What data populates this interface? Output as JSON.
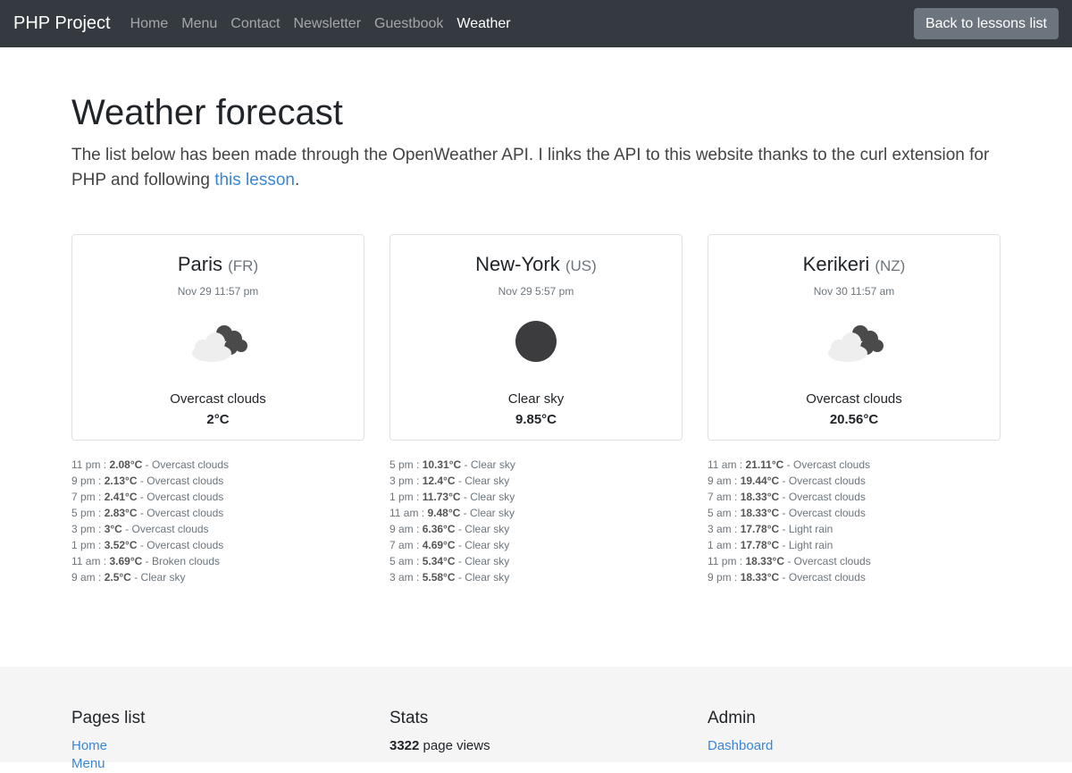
{
  "nav": {
    "brand": "PHP Project",
    "items": [
      "Home",
      "Menu",
      "Contact",
      "Newsletter",
      "Guestbook",
      "Weather"
    ],
    "active": "Weather",
    "back_label": "Back to lessons list"
  },
  "main": {
    "title": "Weather forecast",
    "lead_text": "The list below has been made through the OpenWeather API. I links the API to this website thanks to the curl extension for PHP and following ",
    "lead_link": "this lesson",
    "lead_end": "."
  },
  "cities": [
    {
      "name": "Paris",
      "country": "(FR)",
      "date": "Nov 29 11:57 pm",
      "icon": "overcast-clouds-icon",
      "description": "Overcast clouds",
      "temp": "2°C",
      "forecast": [
        {
          "time": "11 pm",
          "temp": "2.08°C",
          "desc": "Overcast clouds"
        },
        {
          "time": "9 pm",
          "temp": "2.13°C",
          "desc": "Overcast clouds"
        },
        {
          "time": "7 pm",
          "temp": "2.41°C",
          "desc": "Overcast clouds"
        },
        {
          "time": "5 pm",
          "temp": "2.83°C",
          "desc": "Overcast clouds"
        },
        {
          "time": "3 pm",
          "temp": "3°C",
          "desc": "Overcast clouds"
        },
        {
          "time": "1 pm",
          "temp": "3.52°C",
          "desc": "Overcast clouds"
        },
        {
          "time": "11 am",
          "temp": "3.69°C",
          "desc": "Broken clouds"
        },
        {
          "time": "9 am",
          "temp": "2.5°C",
          "desc": "Clear sky"
        }
      ]
    },
    {
      "name": "New-York",
      "country": "(US)",
      "date": "Nov 29 5:57 pm",
      "icon": "clear-night-moon-icon",
      "description": "Clear sky",
      "temp": "9.85°C",
      "forecast": [
        {
          "time": "5 pm",
          "temp": "10.31°C",
          "desc": "Clear sky"
        },
        {
          "time": "3 pm",
          "temp": "12.4°C",
          "desc": "Clear sky"
        },
        {
          "time": "1 pm",
          "temp": "11.73°C",
          "desc": "Clear sky"
        },
        {
          "time": "11 am",
          "temp": "9.48°C",
          "desc": "Clear sky"
        },
        {
          "time": "9 am",
          "temp": "6.36°C",
          "desc": "Clear sky"
        },
        {
          "time": "7 am",
          "temp": "4.69°C",
          "desc": "Clear sky"
        },
        {
          "time": "5 am",
          "temp": "5.34°C",
          "desc": "Clear sky"
        },
        {
          "time": "3 am",
          "temp": "5.58°C",
          "desc": "Clear sky"
        }
      ]
    },
    {
      "name": "Kerikeri",
      "country": "(NZ)",
      "date": "Nov 30 11:57 am",
      "icon": "overcast-clouds-icon",
      "description": "Overcast clouds",
      "temp": "20.56°C",
      "forecast": [
        {
          "time": "11 am",
          "temp": "21.11°C",
          "desc": "Overcast clouds"
        },
        {
          "time": "9 am",
          "temp": "19.44°C",
          "desc": "Overcast clouds"
        },
        {
          "time": "7 am",
          "temp": "18.33°C",
          "desc": "Overcast clouds"
        },
        {
          "time": "5 am",
          "temp": "18.33°C",
          "desc": "Overcast clouds"
        },
        {
          "time": "3 am",
          "temp": "17.78°C",
          "desc": "Light rain"
        },
        {
          "time": "1 am",
          "temp": "17.78°C",
          "desc": "Light rain"
        },
        {
          "time": "11 pm",
          "temp": "18.33°C",
          "desc": "Overcast clouds"
        },
        {
          "time": "9 pm",
          "temp": "18.33°C",
          "desc": "Overcast clouds"
        }
      ]
    }
  ],
  "footer": {
    "pages": {
      "title": "Pages list",
      "links": [
        "Home",
        "Menu"
      ]
    },
    "stats": {
      "title": "Stats",
      "count": "3322",
      "suffix": " page views"
    },
    "admin": {
      "title": "Admin",
      "links": [
        "Dashboard"
      ]
    }
  }
}
